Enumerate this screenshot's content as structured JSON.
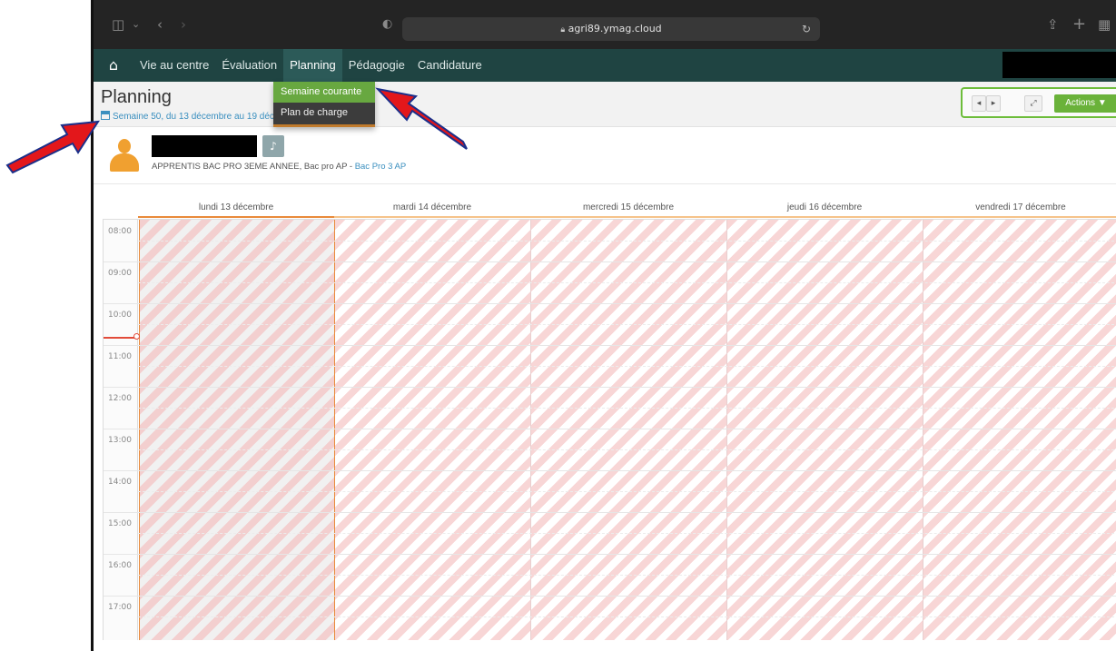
{
  "browser": {
    "url": "agri89.ymag.cloud"
  },
  "nav": {
    "home_icon": "home-icon",
    "items": [
      {
        "label": "Vie au centre"
      },
      {
        "label": "Évaluation"
      },
      {
        "label": "Planning"
      },
      {
        "label": "Pédagogie"
      },
      {
        "label": "Candidature"
      }
    ],
    "active": "Planning"
  },
  "dropdown": {
    "items": [
      {
        "label": "Semaine courante"
      },
      {
        "label": "Plan de charge"
      }
    ]
  },
  "page": {
    "title": "Planning",
    "week_text": "Semaine 50, du 13 décembre au 19 déc"
  },
  "toolbar": {
    "prev": "◂",
    "next": "▸",
    "expand": "⤢",
    "actions": "Actions ▼"
  },
  "learner": {
    "icon": "user-icon",
    "bell": "bell-icon",
    "info": "APPRENTIS BAC PRO 3EME ANNEE, Bac pro AP - ",
    "info_link": "Bac Pro 3 AP"
  },
  "calendar": {
    "days": [
      {
        "label": "lundi 13 décembre"
      },
      {
        "label": "mardi 14 décembre"
      },
      {
        "label": "mercredi 15 décembre"
      },
      {
        "label": "jeudi 16 décembre"
      },
      {
        "label": "vendredi 17 décembre"
      }
    ],
    "hours": [
      "08:00",
      "09:00",
      "10:00",
      "11:00",
      "12:00",
      "13:00",
      "14:00",
      "15:00",
      "16:00",
      "17:00"
    ],
    "today": "lundi 13 décembre",
    "colors": {
      "hatch": "#f8d6d6",
      "today_border": "#e98a3a",
      "now_line": "#e24b3a"
    }
  },
  "colors": {
    "nav_bg": "#1f4442",
    "accent_green": "#6ab23a",
    "link_blue": "#3a8fbf",
    "arrow_red": "#e3171b"
  }
}
